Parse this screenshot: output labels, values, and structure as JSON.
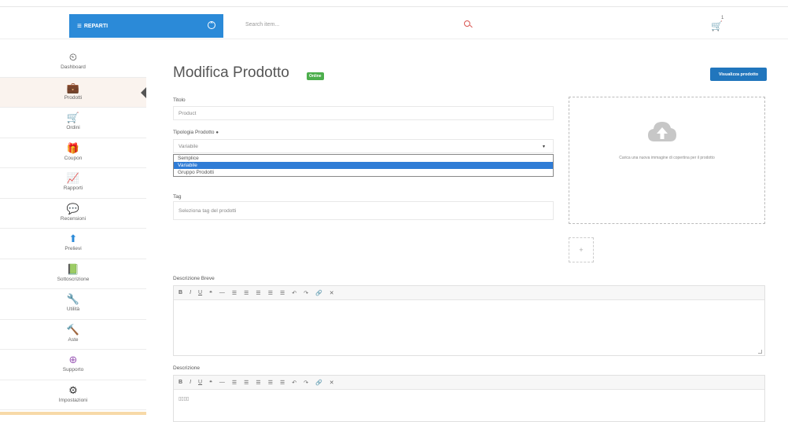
{
  "topbar": {
    "reparti_label": "REPARTI",
    "search_placeholder": "Search item...",
    "cart_count": "1"
  },
  "sidebar": {
    "items": [
      {
        "label": "Dashboard",
        "icon": "dashboard-icon",
        "glyph": "⏲",
        "color": "#333"
      },
      {
        "label": "Prodotti",
        "icon": "briefcase-icon",
        "glyph": "💼",
        "color": "#e83e8c"
      },
      {
        "label": "Ordini",
        "icon": "cart-icon",
        "glyph": "🛒",
        "color": "#2b8ad8"
      },
      {
        "label": "Coupon",
        "icon": "gift-icon",
        "glyph": "🎁",
        "color": "#c0392b"
      },
      {
        "label": "Rapporti",
        "icon": "chart-icon",
        "glyph": "📈",
        "color": "#2b8ad8"
      },
      {
        "label": "Recensioni",
        "icon": "comments-icon",
        "glyph": "💬",
        "color": "#e67e22"
      },
      {
        "label": "Prelievi",
        "icon": "upload-icon",
        "glyph": "⬆",
        "color": "#2b8ad8"
      },
      {
        "label": "Sottoscrizione",
        "icon": "book-icon",
        "glyph": "📗",
        "color": "#27ae60"
      },
      {
        "label": "Utilità",
        "icon": "wrench-icon",
        "glyph": "🔧",
        "color": "#333"
      },
      {
        "label": "Aste",
        "icon": "gavel-icon",
        "glyph": "🔨",
        "color": "#d35400"
      },
      {
        "label": "Supporto",
        "icon": "lifebuoy-icon",
        "glyph": "⊕",
        "color": "#9b59b6"
      },
      {
        "label": "Impostazioni",
        "icon": "gear-icon",
        "glyph": "⚙",
        "color": "#333"
      }
    ],
    "active_index": 1
  },
  "main": {
    "title": "Modifica Prodotto",
    "status_badge": "Online",
    "view_button": "Visualizza prodotto",
    "titolo_label": "Titolo",
    "titolo_value": "Product",
    "tipologia_label": "Tipologia Prodotto",
    "tipologia_value": "Variabile",
    "tipologia_options": [
      "Semplice",
      "Variabile",
      "Gruppo Prodotti"
    ],
    "tipologia_selected": "Variabile",
    "tag_label": "Tag",
    "tag_placeholder": "Seleziona tag del prodotti",
    "upload_text": "Carica una nuova immagine di copertina per il prodotto",
    "add_symbol": "+",
    "descr_breve_label": "Descrizione Breve",
    "descr_label": "Descrizione",
    "descr_value": "▯▯▯▯"
  },
  "toolbar": [
    "B",
    "I",
    "U",
    "❝",
    "—",
    "☰",
    "☰",
    "☰",
    "☰",
    "☰",
    "↶",
    "↷",
    "🔗",
    "✕"
  ],
  "colors": {
    "accent": "#2b8ad8",
    "primary_button": "#2176bd",
    "online_badge": "#4cae4c",
    "selected_option": "#2f7cd6"
  }
}
